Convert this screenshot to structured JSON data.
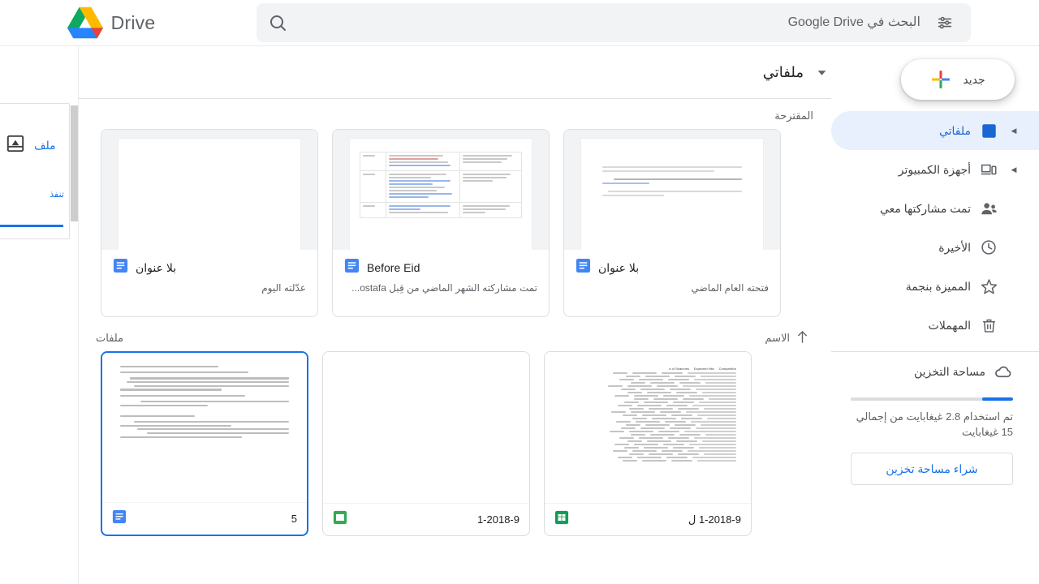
{
  "app": {
    "brand_label": "Drive",
    "logo_icon": "google-drive-logo"
  },
  "search": {
    "placeholder": "البحث في Google Drive",
    "value": "",
    "search_icon": "search-icon",
    "tune_icon": "tune-filter-icon"
  },
  "sidebar": {
    "new_button": {
      "label": "جديد",
      "icon": "plus-icon"
    },
    "items": [
      {
        "label": "ملفاتي",
        "icon": "my-drive-icon",
        "active": true,
        "expandable": true
      },
      {
        "label": "أجهزة الكمبيوتر",
        "icon": "computers-icon",
        "active": false,
        "expandable": true
      },
      {
        "label": "تمت مشاركتها معي",
        "icon": "shared-with-me-icon",
        "active": false,
        "expandable": false
      },
      {
        "label": "الأخيرة",
        "icon": "recent-clock-icon",
        "active": false,
        "expandable": false
      },
      {
        "label": "المميزة بنجمة",
        "icon": "starred-icon",
        "active": false,
        "expandable": false
      },
      {
        "label": "المهملات",
        "icon": "trash-icon",
        "active": false,
        "expandable": false
      }
    ],
    "storage": {
      "label": "مساحة التخزين",
      "icon": "cloud-icon",
      "used_percent": 19,
      "usage_text": "تم استخدام 2.8 غيغابايت من إجمالي 15 غيغابايت",
      "buy_button": "شراء مساحة تخزين"
    }
  },
  "main": {
    "title": "ملفاتي",
    "title_caret_icon": "chevron-down-icon",
    "suggested_label": "المقترحة",
    "suggested": [
      {
        "title": "بلا عنوان",
        "subtitle": "عدّلته اليوم",
        "file_icon": "google-docs-icon",
        "thumb": "arabic-text-document"
      },
      {
        "title": "Before Eid",
        "subtitle": "تمت مشاركته الشهر الماضي من قِبل ostafa...",
        "file_icon": "google-docs-icon",
        "thumb": "table-with-links-document"
      },
      {
        "title": "بلا عنوان",
        "subtitle": "فتحته العام الماضي",
        "file_icon": "google-docs-icon",
        "thumb": "blank-document"
      }
    ],
    "files_label": "ملفات",
    "sort": {
      "label": "الاسم",
      "direction_icon": "arrow-up-icon"
    },
    "files": [
      {
        "name": "5",
        "file_icon": "google-docs-icon",
        "selected": true,
        "thumb": "arabic-article-document"
      },
      {
        "name": "1-2018-9",
        "file_icon": "google-slides-icon",
        "selected": false,
        "thumb": "blank-document"
      },
      {
        "name": "1-2018-9 ل",
        "file_icon": "google-sheets-icon",
        "selected": false,
        "thumb": "spreadsheet-keywords"
      }
    ]
  },
  "left_panel": {
    "title": "ملف",
    "sub": "تنفذ",
    "icon": "drive-backup-icon"
  },
  "scrollbar": {
    "name": "vertical-scrollbar"
  }
}
